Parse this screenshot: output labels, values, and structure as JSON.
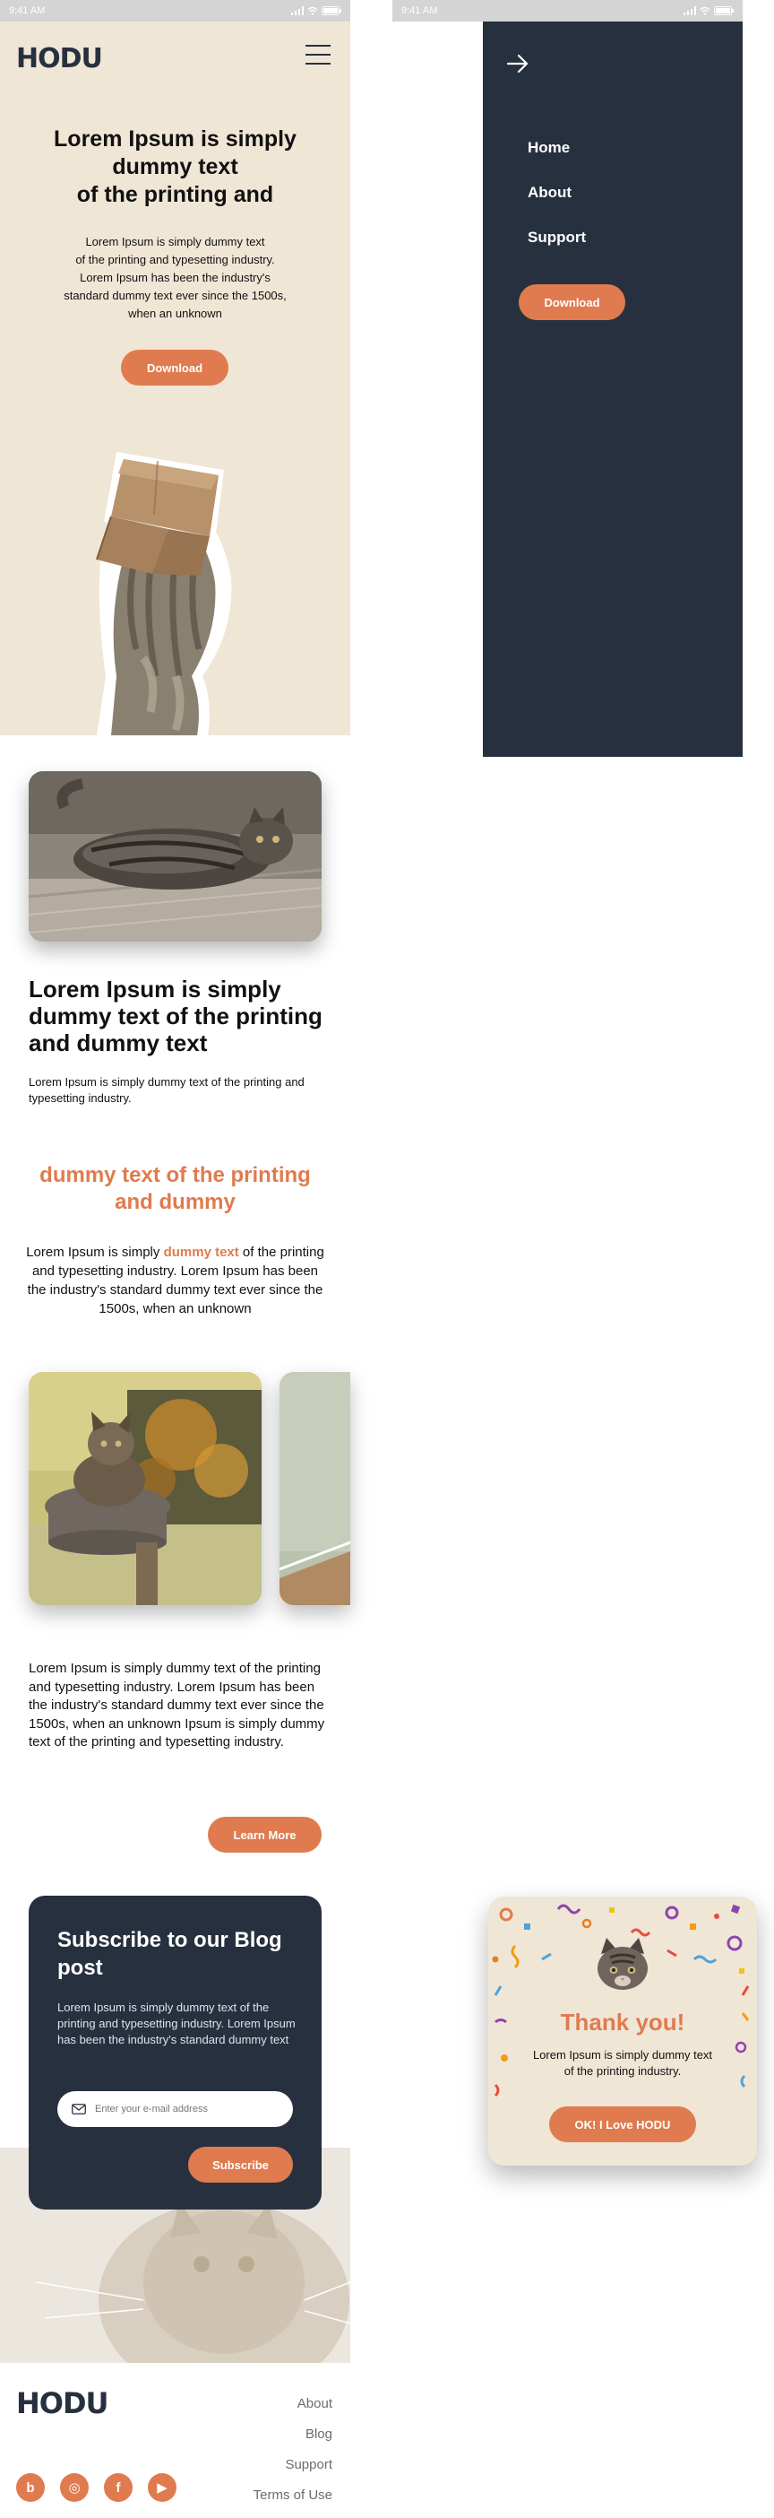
{
  "status_bar": {
    "time": "9:41 AM"
  },
  "brand": {
    "logo": "HODU"
  },
  "colors": {
    "accent": "#e07b4f",
    "navy": "#27303f",
    "cream": "#f0e6d6"
  },
  "icons": {
    "menu": "hamburger-menu-icon",
    "close_menu": "arrow-right-icon",
    "email": "envelope-icon",
    "social": [
      "blogger-icon",
      "instagram-icon",
      "facebook-icon",
      "youtube-icon"
    ]
  },
  "hero": {
    "title": "Lorem Ipsum is simply\ndummy text\nof the printing and",
    "text": "Lorem Ipsum is simply dummy text\nof the printing and typesetting industry.\nLorem Ipsum has been the industry's\nstandard dummy text ever since the 1500s,\nwhen an unknown",
    "button": "Download"
  },
  "section1": {
    "title": "Lorem Ipsum is simply dummy text of the printing and dummy text",
    "text": "Lorem Ipsum is simply dummy text of the printing and typesetting industry."
  },
  "section2": {
    "title": "dummy text of the printing and dummy",
    "text_before": "Lorem Ipsum is simply ",
    "highlight": "dummy text",
    "text_after": " of the printing and typesetting industry. Lorem Ipsum has been the industry's standard dummy text ever since the 1500s, when an unknown"
  },
  "section3": {
    "text": "Lorem Ipsum is simply dummy text of the printing and typesetting industry. Lorem Ipsum has been the industry's standard dummy text ever since the 1500s, when an unknown Ipsum is simply dummy text of the printing and typesetting industry.",
    "button": "Learn More"
  },
  "subscribe": {
    "title": "Subscribe to our Blog post",
    "text": "Lorem Ipsum is simply dummy text of the printing and typesetting industry. Lorem Ipsum has been the industry's standard dummy text",
    "placeholder": "Enter your e-mail address",
    "button": "Subscribe"
  },
  "footer": {
    "links": [
      "About",
      "Blog",
      "Support",
      "Terms of Use"
    ],
    "social_letters": [
      "b",
      "◎",
      "f",
      "▶"
    ]
  },
  "menu": {
    "items": [
      "Home",
      "About",
      "Support"
    ],
    "button": "Download"
  },
  "modal": {
    "title": "Thank you!",
    "text": "Lorem Ipsum is simply dummy text of the printing industry.",
    "button": "OK! I Love HODU"
  }
}
